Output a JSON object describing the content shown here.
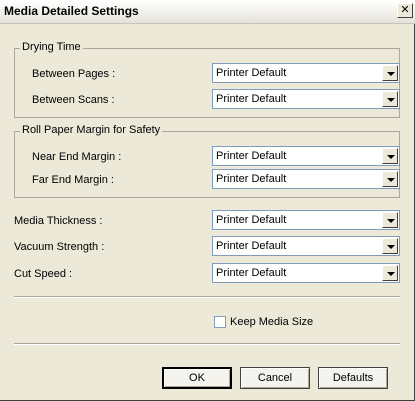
{
  "window": {
    "title": "Media Detailed Settings",
    "close_glyph": "✕"
  },
  "drying_time": {
    "group_label": "Drying Time",
    "between_pages": {
      "label": "Between Pages :",
      "value": "Printer Default"
    },
    "between_scans": {
      "label": "Between Scans :",
      "value": "Printer Default"
    }
  },
  "roll_paper": {
    "group_label": "Roll Paper Margin for Safety",
    "near_end": {
      "label": "Near End Margin :",
      "value": "Printer Default"
    },
    "far_end": {
      "label": "Far End Margin :",
      "value": "Printer Default"
    }
  },
  "media_thickness": {
    "label": "Media Thickness :",
    "value": "Printer Default"
  },
  "vacuum_strength": {
    "label": "Vacuum Strength :",
    "value": "Printer Default"
  },
  "cut_speed": {
    "label": "Cut Speed :",
    "value": "Printer Default"
  },
  "keep_media_size": {
    "label": "Keep Media Size",
    "checked": false
  },
  "buttons": {
    "ok": "OK",
    "cancel": "Cancel",
    "defaults": "Defaults"
  }
}
